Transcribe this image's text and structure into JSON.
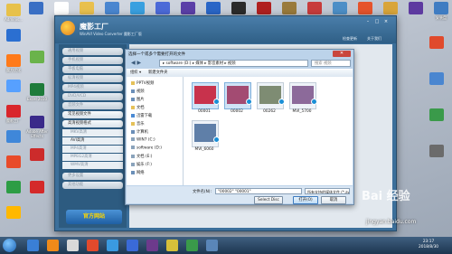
{
  "desktop": {
    "left_icons": [
      {
        "label": "Adminis...",
        "color": "#e7c14a"
      },
      {
        "label": "",
        "color": "#2b6fd1"
      },
      {
        "label": "魔方优化",
        "color": "#ff7a1a"
      },
      {
        "label": "",
        "color": "#57a0ff"
      },
      {
        "label": "魔影工厂",
        "color": "#d9262c"
      },
      {
        "label": "",
        "color": "#3f87d9"
      },
      {
        "label": "",
        "color": "#e84b2a"
      },
      {
        "label": "",
        "color": "#2d9d45"
      },
      {
        "label": "",
        "color": "#ffb800"
      }
    ],
    "second_col_icons": [
      {
        "label": "",
        "color": "#6ab34b"
      },
      {
        "label": "Excel 2010",
        "color": "#1e7b3a"
      },
      {
        "label": "Adobe After Effects",
        "color": "#3a2a8a"
      },
      {
        "label": "",
        "color": "#cc2b2b"
      },
      {
        "label": "",
        "color": "#d42a2a"
      }
    ],
    "top_icons": [
      {
        "label": "",
        "color": "#3a6fc4"
      },
      {
        "label": "",
        "color": "#ffffff"
      },
      {
        "label": "",
        "color": "#e9c04e"
      },
      {
        "label": "",
        "color": "#4a86d0"
      },
      {
        "label": "",
        "color": "#39a0e0"
      },
      {
        "label": "",
        "color": "#4c6ad8"
      },
      {
        "label": "",
        "color": "#5b3fa8"
      },
      {
        "label": "",
        "color": "#2a66c7"
      },
      {
        "label": "",
        "color": "#2b2b2b"
      },
      {
        "label": "",
        "color": "#b02020"
      },
      {
        "label": "",
        "color": "#9a7b3c"
      },
      {
        "label": "",
        "color": "#c83c3c"
      },
      {
        "label": "",
        "color": "#4d8fc7"
      },
      {
        "label": "",
        "color": "#e6542c"
      },
      {
        "label": "",
        "color": "#d9a53a"
      },
      {
        "label": "",
        "color": "#5d3aa0"
      },
      {
        "label": "安装盘",
        "color": "#3f7cc2"
      }
    ],
    "right_icons": [
      {
        "label": "",
        "color": "#e04a2c"
      },
      {
        "label": "",
        "color": "#4a86d0"
      },
      {
        "label": "",
        "color": "#3a9a4a"
      },
      {
        "label": "",
        "color": "#6b6b6b"
      }
    ]
  },
  "app": {
    "name": "魔影工厂",
    "subtitle": "WinAVI Video Converter 魔影工厂版",
    "top_links": [
      "检查更新",
      "关于我们"
    ],
    "accent": "#3c6f9a",
    "sidebar": {
      "items": [
        {
          "label": "通用视频",
          "active": false
        },
        {
          "label": "手机视频",
          "active": false
        },
        {
          "label": "平板电脑",
          "active": false
        },
        {
          "label": "标清视频",
          "active": false
        },
        {
          "label": "MP4视频",
          "active": false
        },
        {
          "label": "DVD/VCD",
          "active": false
        },
        {
          "label": "音频文件",
          "active": false
        },
        {
          "label": "常见视频文件",
          "active": true
        }
      ],
      "group_label": "高清视频格式",
      "sub_items": [
        {
          "label": "MKV高清",
          "active": false
        },
        {
          "label": "AVI高清",
          "active": true
        },
        {
          "label": "MP4高清",
          "active": false
        },
        {
          "label": "MPEG2高清",
          "active": false
        },
        {
          "label": "WMV高清",
          "active": false
        }
      ],
      "more_items": [
        {
          "label": "更多设置",
          "active": false
        },
        {
          "label": "其他功能",
          "active": false
        }
      ],
      "promo": "官方网站"
    }
  },
  "dialog": {
    "title": "选择一个或多个需要打开的文件",
    "close_label": "✕",
    "address": "▸ software (D:) ▸ 媒体 ▸ 影音素材 ▸ 视频",
    "search_placeholder": "搜索 视频",
    "toolbar": {
      "organize": "组织 ▾",
      "new_folder": "新建文件夹"
    },
    "tree": [
      {
        "label": "PPTV视频",
        "color": "#e5c158"
      },
      {
        "label": "视频",
        "color": "#6b8fb8"
      },
      {
        "label": "图片",
        "color": "#6b8fb8"
      },
      {
        "label": "文档",
        "color": "#e5c158"
      },
      {
        "label": "迅雷下载",
        "color": "#4a8ad4"
      },
      {
        "label": "音乐",
        "color": "#e5c158"
      },
      {
        "label": "计算机",
        "color": "#6b8fb8"
      },
      {
        "label": "WIN7 (C:)",
        "color": "#8aa3bb"
      },
      {
        "label": "software (D:)",
        "color": "#8aa3bb"
      },
      {
        "label": "文档 (E:)",
        "color": "#8aa3bb"
      },
      {
        "label": "娱乐 (F:)",
        "color": "#8aa3bb"
      },
      {
        "label": "网络",
        "color": "#6b8fb8"
      }
    ],
    "files": [
      {
        "name": "00001",
        "selected": true,
        "color": "#c8324c"
      },
      {
        "name": "00002",
        "selected": true,
        "color": "#a34b72"
      },
      {
        "name": "00262",
        "selected": false,
        "color": "#7e8c73"
      },
      {
        "name": "MVI_5700",
        "selected": false,
        "color": "#8c6a9a"
      },
      {
        "name": "MVI_6060",
        "selected": false,
        "color": "#5f7fa8"
      }
    ],
    "filename_label": "文件名(N):",
    "filename_value": "\"00002\" \"00001\"",
    "filetype": "所有支持的媒体文件 (*.avi;*.as",
    "select_disc": "Select Disc",
    "open": "打开(O)",
    "cancel": "取消"
  },
  "taskbar": {
    "icons": [
      {
        "color": "#3a7fd5"
      },
      {
        "color": "#f08a1a"
      },
      {
        "color": "#d9d9d9"
      },
      {
        "color": "#e24a2c"
      },
      {
        "color": "#3a9ae0"
      },
      {
        "color": "#3a6ad8"
      },
      {
        "color": "#6d3a8c"
      },
      {
        "color": "#d6c03a"
      },
      {
        "color": "#3a9a4a"
      },
      {
        "color": "#5a86b8"
      }
    ],
    "time": "23:17",
    "date": "2018/8/30"
  },
  "watermark": {
    "text": "Bai 经验",
    "url": "jingyan.baidu.com"
  }
}
